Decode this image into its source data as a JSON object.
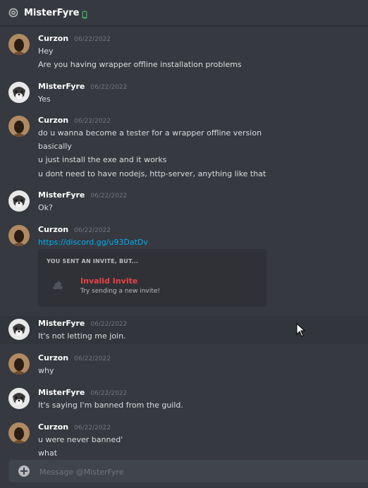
{
  "header": {
    "title": "MisterFyre",
    "at_icon": "at-icon",
    "status_icon": "mobile-icon",
    "status_color": "#3ba55c"
  },
  "messages": [
    {
      "author": "Curzon",
      "timestamp": "06/22/2022",
      "avatar": "curzon",
      "lines": [
        "Hey",
        "Are you having wrapper offline installation problems"
      ]
    },
    {
      "author": "MisterFyre",
      "timestamp": "06/22/2022",
      "avatar": "mister",
      "lines": [
        "Yes"
      ]
    },
    {
      "author": "Curzon",
      "timestamp": "06/22/2022",
      "avatar": "curzon",
      "lines": [
        "do u wanna become a tester for a wrapper offline version",
        "basically",
        "u just install the exe and it works",
        "u dont need to have nodejs, http-server, anything like that"
      ]
    },
    {
      "author": "MisterFyre",
      "timestamp": "06/22/2022",
      "avatar": "mister",
      "lines": [
        "Ok?"
      ]
    },
    {
      "author": "Curzon",
      "timestamp": "06/22/2022",
      "avatar": "curzon",
      "lines": [
        "https://discord.gg/u93DatDv"
      ]
    },
    {
      "author": "MisterFyre",
      "timestamp": "06/22/2022",
      "avatar": "mister",
      "lines": [
        "It's not letting me join."
      ]
    },
    {
      "author": "Curzon",
      "timestamp": "06/22/2022",
      "avatar": "curzon",
      "lines": [
        "why"
      ]
    },
    {
      "author": "MisterFyre",
      "timestamp": "06/22/2022",
      "avatar": "mister",
      "lines": [
        "It's saying I'm banned from the guild."
      ]
    },
    {
      "author": "Curzon",
      "timestamp": "06/22/2022",
      "avatar": "curzon",
      "lines": [
        "u were never banned'",
        "what"
      ]
    }
  ],
  "invite": {
    "label": "YOU SENT AN INVITE, BUT...",
    "title": "Invalid Invite",
    "subtitle": "Try sending a new invite!"
  },
  "composer": {
    "placeholder": "Message @MisterFyre"
  },
  "colors": {
    "background": "#36393f",
    "link": "#00aff4",
    "invalid": "#ed4245"
  }
}
